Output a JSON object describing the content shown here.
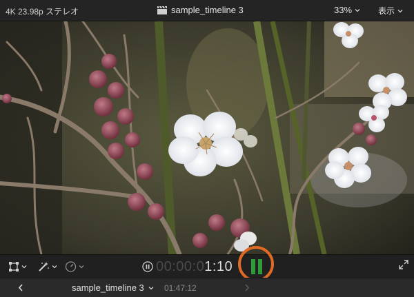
{
  "topbar": {
    "format_info": "4K 23.98p ステレオ",
    "project_icon": "clapperboard-icon",
    "project_title": "sample_timeline 3",
    "zoom_label": "33%",
    "view_label": "表示"
  },
  "controlbar": {
    "transform_icon": "transform-icon",
    "effects_icon": "magic-wand-icon",
    "speed_icon": "speedometer-icon",
    "play_icon": "pause-circle-icon",
    "timecode_dim": "00:00:0",
    "timecode_bright": "1:10",
    "meter_icon": "audio-meter-icon",
    "fullscreen_icon": "fullscreen-icon"
  },
  "navbar": {
    "prev_icon": "chevron-left-icon",
    "timeline_title": "sample_timeline 3",
    "duration": "01:47:12",
    "next_icon": "chevron-right-icon"
  },
  "colors": {
    "highlight_ring": "#e06a23",
    "meter_green": "#2f9a3a"
  }
}
